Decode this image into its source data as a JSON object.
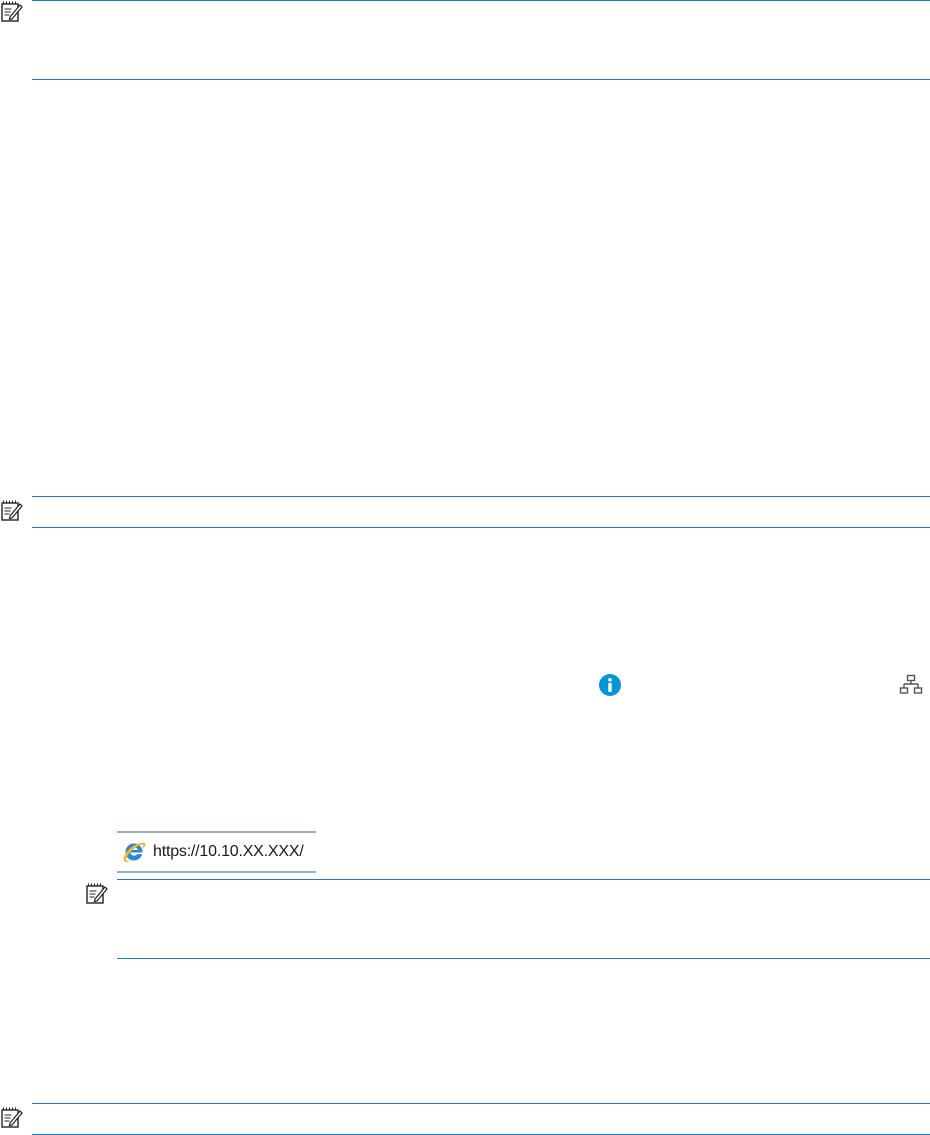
{
  "address_bar": {
    "url": "https://10.10.XX.XXX/"
  },
  "icons": {
    "note": "note-icon",
    "info": "info-icon",
    "network": "network-icon",
    "browser": "internet-explorer-icon"
  },
  "colors": {
    "rule": "#1a7bb8",
    "info": "#0096d6",
    "network": "#555555"
  }
}
